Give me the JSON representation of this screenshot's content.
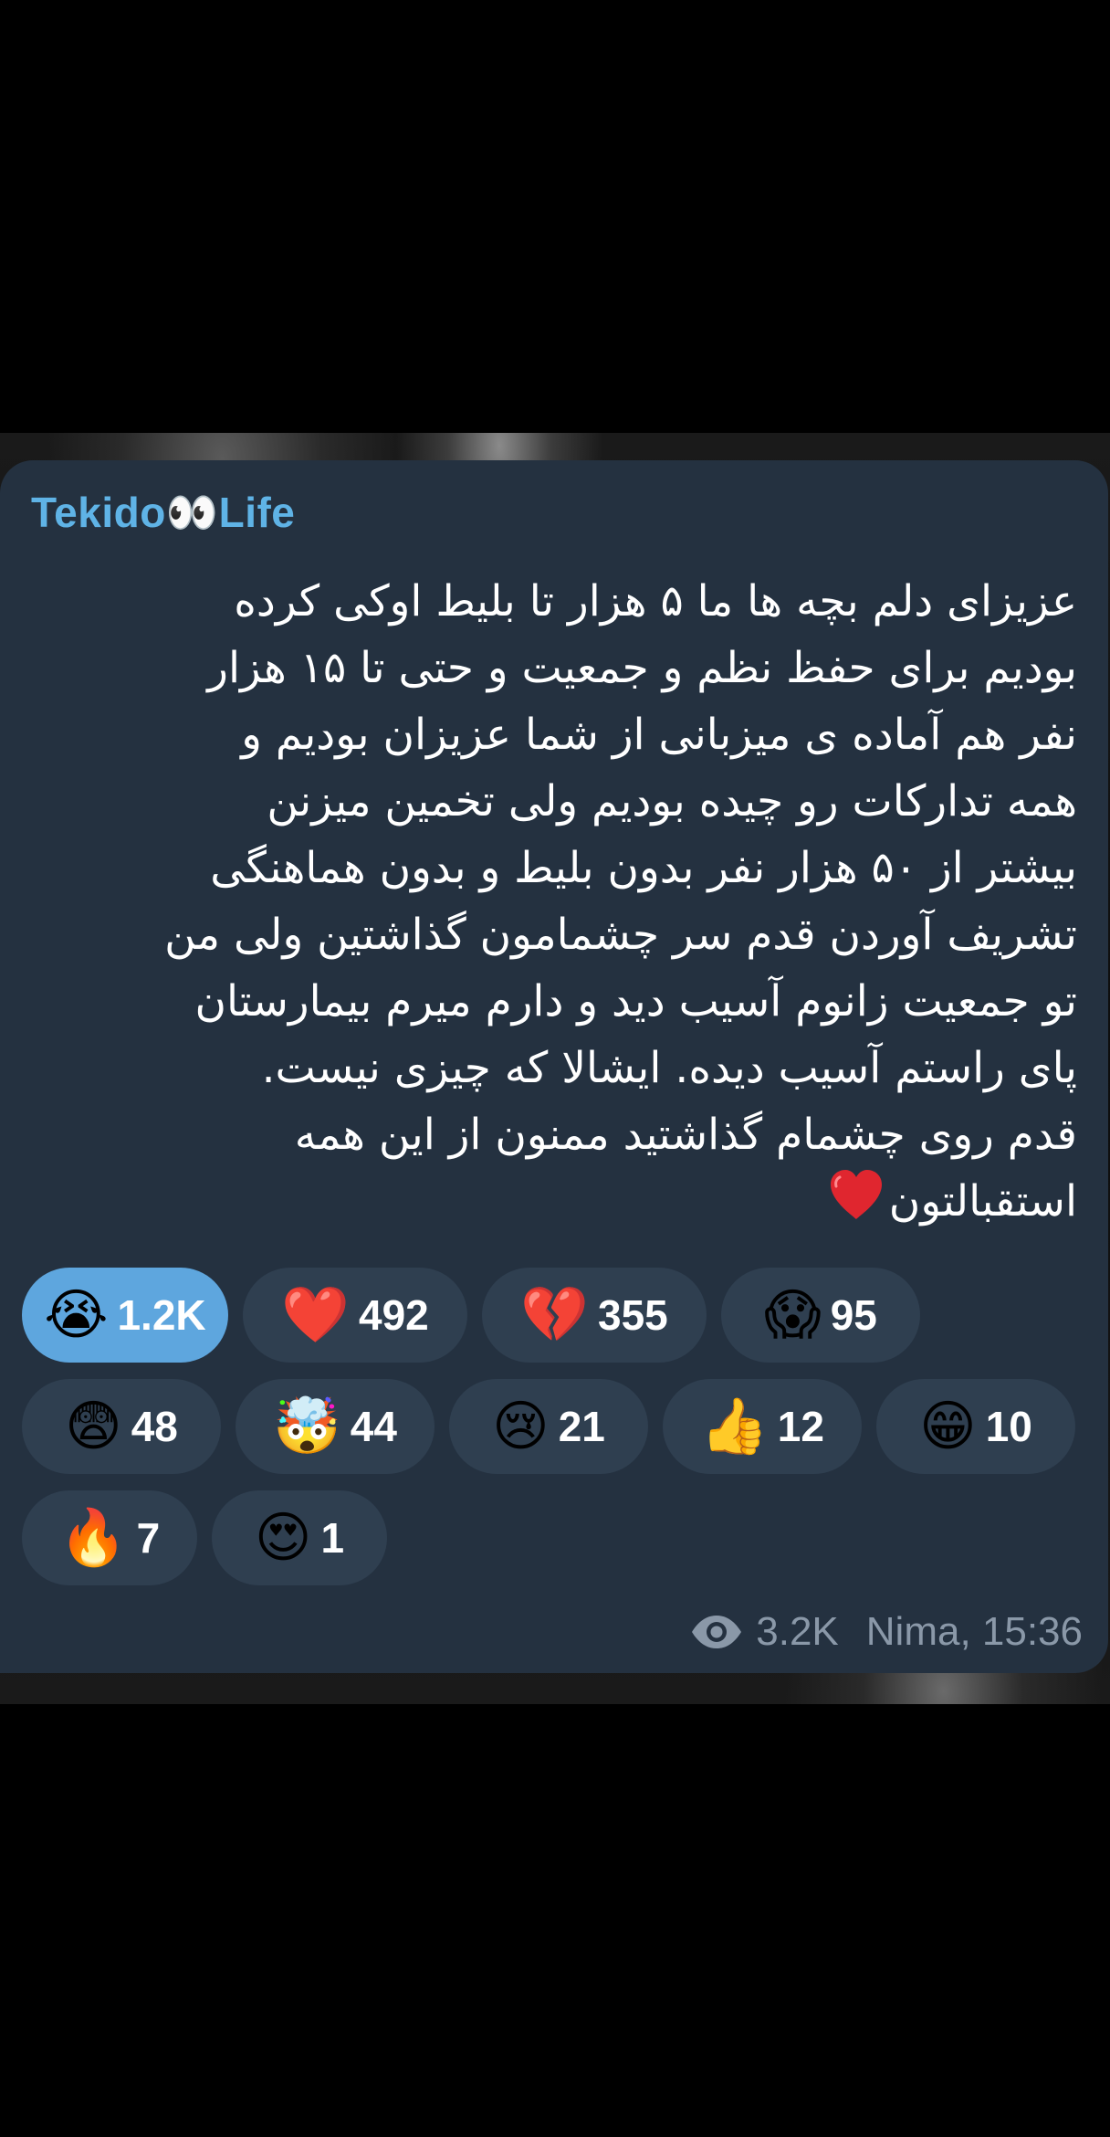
{
  "channel": {
    "name": "Tekido👀Life"
  },
  "message": {
    "lines": [
      "عزیزای دلم بچه ها ما ۵ هزار تا بلیط اوکی کرده",
      "بودیم برای حفظ نظم و جمعیت و حتی تا ۱۵ هزار",
      "نفر هم آماده ی میزبانی از شما عزیزان بودیم و",
      "همه تدارکات رو چیده بودیم ولی تخمین میزنن",
      "بیشتر از ۵۰ هزار نفر بدون بلیط و بدون هماهنگی",
      "تشریف آوردن قدم سر چشمامون گذاشتین ولی من",
      "تو جمعیت زانوم آسیب دید و دارم میرم بیمارستان",
      "پای راستم آسیب دیده. ایشالا که چیزی نیست.",
      "قدم روی چشمام گذاشتید ممنون از این همه",
      "استقبالتون"
    ],
    "trailing_emoji": "heart-emoji"
  },
  "reactions": [
    [
      {
        "emoji": "😭",
        "icon": "loudly-crying-face-icon",
        "count": "1.2K",
        "active": true
      },
      {
        "emoji": "❤️",
        "icon": "red-heart-icon",
        "count": "492"
      },
      {
        "emoji": "💔",
        "icon": "broken-heart-icon",
        "count": "355"
      },
      {
        "emoji": "😱",
        "icon": "screaming-face-icon",
        "count": "95"
      }
    ],
    [
      {
        "emoji": "😨",
        "icon": "fearful-face-icon",
        "count": "48"
      },
      {
        "emoji": "🤯",
        "icon": "exploding-head-icon",
        "count": "44"
      },
      {
        "emoji": "😢",
        "icon": "crying-face-icon",
        "count": "21"
      },
      {
        "emoji": "👍",
        "icon": "thumbs-up-icon",
        "count": "12"
      },
      {
        "emoji": "😁",
        "icon": "grinning-face-icon",
        "count": "10"
      }
    ],
    [
      {
        "emoji": "🔥",
        "icon": "fire-icon",
        "count": "7"
      },
      {
        "emoji": "😍",
        "icon": "heart-eyes-icon",
        "count": "1"
      }
    ]
  ],
  "footer": {
    "views": "3.2K",
    "author_time": "Nima, 15:36"
  },
  "colors": {
    "bubble": "#243140",
    "chip": "#2f3f50",
    "chip_active": "#5ea6de",
    "sender": "#5fb3e6",
    "meta": "#8a98a8"
  }
}
